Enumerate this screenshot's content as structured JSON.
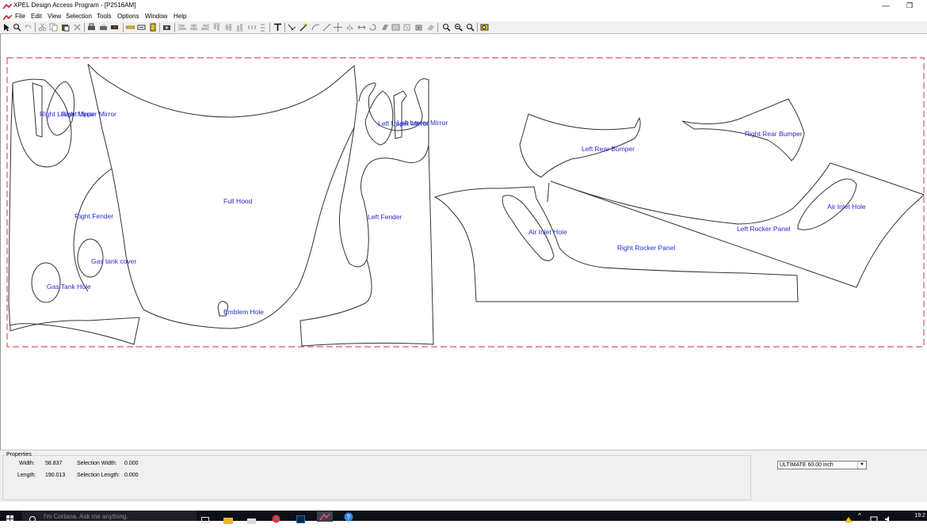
{
  "window": {
    "title": "XPEL Design Access Program - [P2516AM]",
    "minimize_glyph": "—",
    "restore_glyph": "❐"
  },
  "menu": {
    "items": [
      "File",
      "Edit",
      "View",
      "Selection",
      "Tools",
      "Options",
      "Window",
      "Help"
    ]
  },
  "toolbar": {
    "tools": [
      "select-arrow-icon",
      "zoom-lens-icon",
      "undo-icon",
      "cut-icon",
      "copy-icon",
      "paste-icon",
      "delete-icon",
      "print-icon",
      "print-preview-icon",
      "plotter-icon",
      "measure-icon",
      "film-roll-icon",
      "door-icon",
      "camera-icon",
      "align-left-icon",
      "align-center-icon",
      "align-right-icon",
      "align-top-icon",
      "align-middle-icon",
      "align-bottom-icon",
      "distribute-horizontal-icon",
      "distribute-vertical-icon",
      "text-tool-icon",
      "node-edit-icon",
      "knife-icon",
      "curve-icon",
      "line-icon",
      "move-icon",
      "mirror-icon",
      "stretch-icon",
      "rotate-icon",
      "group-icon",
      "ungroup-icon",
      "weld-icon",
      "zoom-in-icon",
      "zoom-out-icon",
      "zoom-fit-icon",
      "zoom-all-icon"
    ]
  },
  "canvas": {
    "labels": {
      "right_lower_mirror": "Right Lower Mirror",
      "right_upper_mirror": "Right Upper Mirror",
      "left_upper_mirror": "Left Upper Mirror",
      "left_lower_mirror": "Left Lower Mirror",
      "full_hood": "Full Hood",
      "right_fender": "Right Fender",
      "left_fender": "Left Fender",
      "gas_tank_cover": "Gas tank cover",
      "gas_tank_hole": "Gas Tank Hole",
      "emblem_hole": "Emblem Hole",
      "left_rear_bumper": "Left Rear Bumper",
      "right_rear_bumper": "Right Rear Bumper",
      "air_inlet_hole_left": "Air Inlet Hole",
      "air_inlet_hole_right": "Air Inlet Hole",
      "right_rocker_panel": "Right Rocker Panel",
      "left_rocker_panel": "Left Rocker Panel"
    },
    "colors": {
      "cut_line": "#333333",
      "label": "#2a2ad0",
      "border": "#e8505a"
    }
  },
  "properties": {
    "title": "Properties",
    "width_label": "Width:",
    "width_value": "58.837",
    "length_label": "Length:",
    "length_value": "190.013",
    "sel_width_label": "Selection Width:",
    "sel_width_value": "0.000",
    "sel_length_label": "Selection Length:",
    "sel_length_value": "0.000",
    "film_select_value": "ULTIMATE  60.00 inch"
  },
  "taskbar": {
    "cortana_placeholder": "I'm Cortana. Ask me anything.",
    "clock": "19:2"
  }
}
